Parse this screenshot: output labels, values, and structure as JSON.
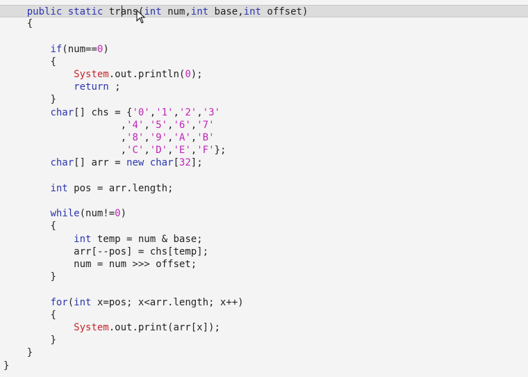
{
  "editor": {
    "lines": [
      {
        "indent": "    ",
        "highlight": true,
        "tokens": [
          [
            "kw",
            "public"
          ],
          [
            "p",
            " "
          ],
          [
            "kw",
            "static"
          ],
          [
            "p",
            " "
          ],
          [
            "p",
            "trans"
          ],
          [
            "p",
            "("
          ],
          [
            "kw",
            "int"
          ],
          [
            "p",
            " num,"
          ],
          [
            "kw",
            "int"
          ],
          [
            "p",
            " base,"
          ],
          [
            "kw",
            "int"
          ],
          [
            "p",
            " offset)"
          ]
        ]
      },
      {
        "indent": "    ",
        "tokens": [
          [
            "p",
            "{"
          ]
        ]
      },
      {
        "indent": "",
        "tokens": []
      },
      {
        "indent": "        ",
        "tokens": [
          [
            "kw",
            "if"
          ],
          [
            "p",
            "(num=="
          ],
          [
            "num",
            "0"
          ],
          [
            "p",
            ")"
          ]
        ]
      },
      {
        "indent": "        ",
        "tokens": [
          [
            "p",
            "{"
          ]
        ]
      },
      {
        "indent": "            ",
        "tokens": [
          [
            "cls",
            "System"
          ],
          [
            "p",
            ".out.println("
          ],
          [
            "num",
            "0"
          ],
          [
            "p",
            ");"
          ]
        ]
      },
      {
        "indent": "            ",
        "tokens": [
          [
            "kw",
            "return"
          ],
          [
            "p",
            " ;"
          ]
        ]
      },
      {
        "indent": "        ",
        "tokens": [
          [
            "p",
            "}"
          ]
        ]
      },
      {
        "indent": "        ",
        "tokens": [
          [
            "kw",
            "char"
          ],
          [
            "p",
            "[] chs = {"
          ],
          [
            "str",
            "'0'"
          ],
          [
            "p",
            ","
          ],
          [
            "str",
            "'1'"
          ],
          [
            "p",
            ","
          ],
          [
            "str",
            "'2'"
          ],
          [
            "p",
            ","
          ],
          [
            "str",
            "'3'"
          ]
        ]
      },
      {
        "indent": "                    ",
        "tokens": [
          [
            "p",
            ","
          ],
          [
            "str",
            "'4'"
          ],
          [
            "p",
            ","
          ],
          [
            "str",
            "'5'"
          ],
          [
            "p",
            ","
          ],
          [
            "str",
            "'6'"
          ],
          [
            "p",
            ","
          ],
          [
            "str",
            "'7'"
          ]
        ]
      },
      {
        "indent": "                    ",
        "tokens": [
          [
            "p",
            ","
          ],
          [
            "str",
            "'8'"
          ],
          [
            "p",
            ","
          ],
          [
            "str",
            "'9'"
          ],
          [
            "p",
            ","
          ],
          [
            "str",
            "'A'"
          ],
          [
            "p",
            ","
          ],
          [
            "str",
            "'B'"
          ]
        ]
      },
      {
        "indent": "                    ",
        "tokens": [
          [
            "p",
            ","
          ],
          [
            "str",
            "'C'"
          ],
          [
            "p",
            ","
          ],
          [
            "str",
            "'D'"
          ],
          [
            "p",
            ","
          ],
          [
            "str",
            "'E'"
          ],
          [
            "p",
            ","
          ],
          [
            "str",
            "'F'"
          ],
          [
            "p",
            "};"
          ]
        ]
      },
      {
        "indent": "        ",
        "tokens": [
          [
            "kw",
            "char"
          ],
          [
            "p",
            "[] arr = "
          ],
          [
            "kw",
            "new"
          ],
          [
            "p",
            " "
          ],
          [
            "kw",
            "char"
          ],
          [
            "p",
            "["
          ],
          [
            "num",
            "32"
          ],
          [
            "p",
            "];"
          ]
        ]
      },
      {
        "indent": "",
        "tokens": []
      },
      {
        "indent": "        ",
        "tokens": [
          [
            "kw",
            "int"
          ],
          [
            "p",
            " pos = arr.length;"
          ]
        ]
      },
      {
        "indent": "",
        "tokens": []
      },
      {
        "indent": "        ",
        "tokens": [
          [
            "kw",
            "while"
          ],
          [
            "p",
            "(num!="
          ],
          [
            "num",
            "0"
          ],
          [
            "p",
            ")"
          ]
        ]
      },
      {
        "indent": "        ",
        "tokens": [
          [
            "p",
            "{"
          ]
        ]
      },
      {
        "indent": "            ",
        "tokens": [
          [
            "kw",
            "int"
          ],
          [
            "p",
            " temp = num & base;"
          ]
        ]
      },
      {
        "indent": "            ",
        "tokens": [
          [
            "p",
            "arr[--pos] = chs[temp];"
          ]
        ]
      },
      {
        "indent": "            ",
        "tokens": [
          [
            "p",
            "num = num >>> offset;"
          ]
        ]
      },
      {
        "indent": "        ",
        "tokens": [
          [
            "p",
            "}"
          ]
        ]
      },
      {
        "indent": "",
        "tokens": []
      },
      {
        "indent": "        ",
        "tokens": [
          [
            "kw",
            "for"
          ],
          [
            "p",
            "("
          ],
          [
            "kw",
            "int"
          ],
          [
            "p",
            " x=pos; x<arr.length; x++)"
          ]
        ]
      },
      {
        "indent": "        ",
        "tokens": [
          [
            "p",
            "{"
          ]
        ]
      },
      {
        "indent": "            ",
        "tokens": [
          [
            "cls",
            "System"
          ],
          [
            "p",
            ".out.print(arr[x]);"
          ]
        ]
      },
      {
        "indent": "        ",
        "tokens": [
          [
            "p",
            "}"
          ]
        ]
      },
      {
        "indent": "    ",
        "tokens": [
          [
            "p",
            "}"
          ]
        ]
      },
      {
        "indent": "",
        "tokens": [
          [
            "p",
            "}"
          ]
        ]
      }
    ],
    "colors": {
      "keyword": "#2b35b0",
      "class": "#c7252b",
      "literal": "#c023b8",
      "text": "#222222",
      "background": "#f4f4f4",
      "current_line": "#dcdcdc"
    },
    "icons": [
      "mouse-pointer-icon"
    ]
  }
}
